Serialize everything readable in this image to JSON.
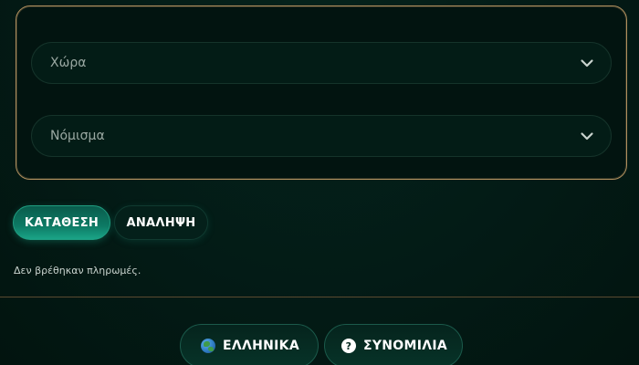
{
  "filters": {
    "country_label": "Χώρα",
    "currency_label": "Νόμισμα"
  },
  "tabs": [
    {
      "label": "ΚΑΤΑΘΕΣΗ",
      "active": true
    },
    {
      "label": "ΑΝΑΛΗΨΗ",
      "active": false
    }
  ],
  "empty_message": "Δεν βρέθηκαν πληρωμές.",
  "footer": {
    "language_label": "ΕΛΛΗΝΙΚΑ",
    "language_icon": "globe-icon",
    "support_label": "ΣΥΝΟΜΙΛΙΑ",
    "support_icon": "question-icon",
    "support_icon_glyph": "?"
  },
  "colors": {
    "background": "#031a15",
    "panel_border": "#b08f5e",
    "active_tab": "#0d7a64",
    "text": "#ffffff"
  }
}
